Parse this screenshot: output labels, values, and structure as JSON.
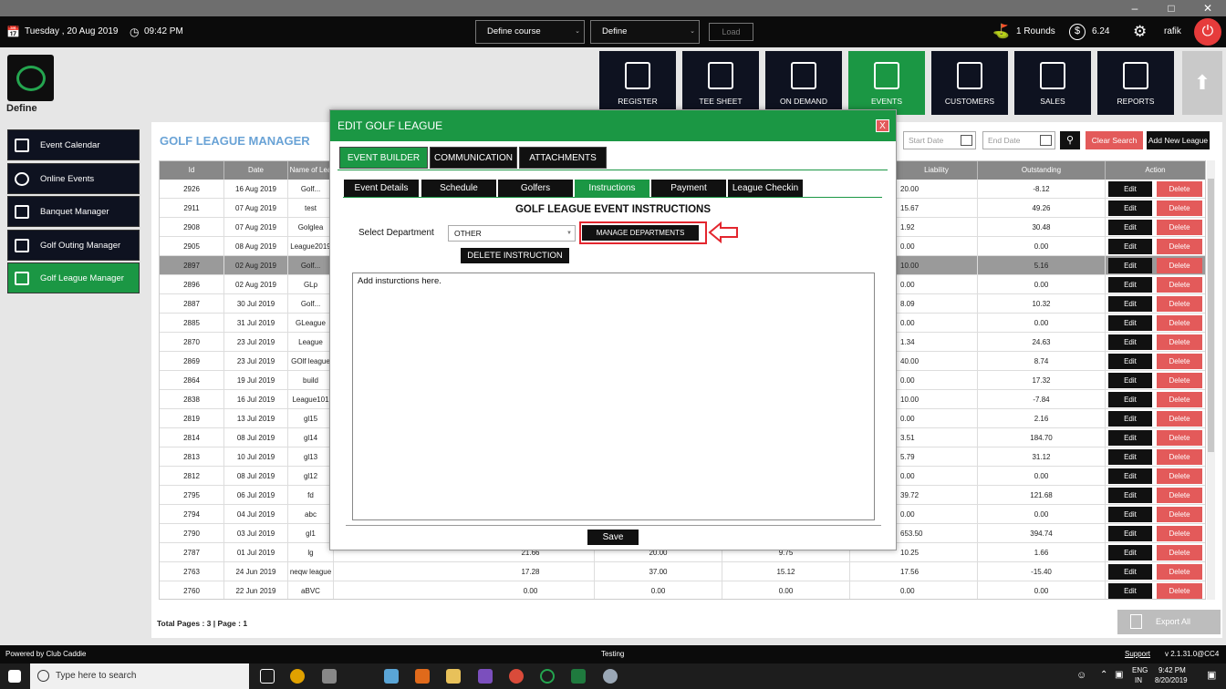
{
  "topbar": {
    "date": "Tuesday ,  20 Aug 2019",
    "time": "09:42 PM",
    "course_select": "Define course",
    "define_select": "Define",
    "load_label": "Load",
    "rounds": "1 Rounds",
    "balance": "6.24",
    "user": "rafik"
  },
  "brand": "Define",
  "nav": [
    {
      "label": "REGISTER",
      "icon": "barcode-scanner-icon"
    },
    {
      "label": "TEE SHEET",
      "icon": "tee-sheet-icon"
    },
    {
      "label": "ON DEMAND",
      "icon": "mobile-icon"
    },
    {
      "label": "EVENTS",
      "icon": "events-calendar-icon",
      "active": true
    },
    {
      "label": "CUSTOMERS",
      "icon": "customers-icon"
    },
    {
      "label": "SALES",
      "icon": "sales-icon"
    },
    {
      "label": "REPORTS",
      "icon": "reports-icon"
    }
  ],
  "sidebar": [
    {
      "label": "Event Calendar"
    },
    {
      "label": "Online Events"
    },
    {
      "label": "Banquet Manager"
    },
    {
      "label": "Golf Outing Manager"
    },
    {
      "label": "Golf League Manager",
      "active": true
    }
  ],
  "page": {
    "title": "GOLF LEAGUE MANAGER",
    "start_date_placeholder": "Start Date",
    "end_date_placeholder": "End Date",
    "clear_search": "Clear Search",
    "add_new": "Add New League",
    "total_pages": "Total Pages : 3 | Page : 1",
    "export_all": "Export All"
  },
  "table": {
    "headers": [
      "Id",
      "Date",
      "Name of Lea",
      "",
      "",
      "",
      "",
      "",
      "Liability",
      "Outstanding",
      "Action"
    ],
    "edit_label": "Edit",
    "delete_label": "Delete",
    "rows": [
      {
        "id": "2926",
        "date": "16 Aug 2019",
        "name": "Golf...",
        "c4": "",
        "c5": "",
        "c6": "",
        "liability": "20.00",
        "outstanding": "-8.12"
      },
      {
        "id": "2911",
        "date": "07 Aug 2019",
        "name": "test",
        "c4": "",
        "c5": "",
        "c6": "",
        "liability": "15.67",
        "outstanding": "49.26"
      },
      {
        "id": "2908",
        "date": "07 Aug 2019",
        "name": "Golglea",
        "c4": "",
        "c5": "",
        "c6": "",
        "liability": "1.92",
        "outstanding": "30.48"
      },
      {
        "id": "2905",
        "date": "08 Aug 2019",
        "name": "League2019",
        "c4": "",
        "c5": "",
        "c6": "",
        "liability": "0.00",
        "outstanding": "0.00"
      },
      {
        "id": "2897",
        "date": "02 Aug 2019",
        "name": "Golf...",
        "c4": "",
        "c5": "",
        "c6": "",
        "liability": "10.00",
        "outstanding": "5.16",
        "selected": true
      },
      {
        "id": "2896",
        "date": "02 Aug 2019",
        "name": "GLp",
        "c4": "",
        "c5": "",
        "c6": "",
        "liability": "0.00",
        "outstanding": "0.00"
      },
      {
        "id": "2887",
        "date": "30 Jul 2019",
        "name": "Golf...",
        "c4": "",
        "c5": "",
        "c6": "",
        "liability": "8.09",
        "outstanding": "10.32"
      },
      {
        "id": "2885",
        "date": "31 Jul 2019",
        "name": "GLeague",
        "c4": "",
        "c5": "",
        "c6": "",
        "liability": "0.00",
        "outstanding": "0.00"
      },
      {
        "id": "2870",
        "date": "23 Jul 2019",
        "name": "League",
        "c4": "",
        "c5": "",
        "c6": "",
        "liability": "1.34",
        "outstanding": "24.63"
      },
      {
        "id": "2869",
        "date": "23 Jul 2019",
        "name": "GOlf league",
        "c4": "",
        "c5": "",
        "c6": "",
        "liability": "40.00",
        "outstanding": "8.74"
      },
      {
        "id": "2864",
        "date": "19 Jul 2019",
        "name": "build",
        "c4": "",
        "c5": "",
        "c6": "",
        "liability": "0.00",
        "outstanding": "17.32"
      },
      {
        "id": "2838",
        "date": "16 Jul 2019",
        "name": "League101",
        "c4": "",
        "c5": "",
        "c6": "",
        "liability": "10.00",
        "outstanding": "-7.84"
      },
      {
        "id": "2819",
        "date": "13 Jul 2019",
        "name": "gl15",
        "c4": "",
        "c5": "",
        "c6": "",
        "liability": "0.00",
        "outstanding": "2.16"
      },
      {
        "id": "2814",
        "date": "08 Jul 2019",
        "name": "gl14",
        "c4": "",
        "c5": "",
        "c6": "",
        "liability": "3.51",
        "outstanding": "184.70"
      },
      {
        "id": "2813",
        "date": "10 Jul 2019",
        "name": "gl13",
        "c4": "",
        "c5": "",
        "c6": "",
        "liability": "5.79",
        "outstanding": "31.12"
      },
      {
        "id": "2812",
        "date": "08 Jul 2019",
        "name": "gl12",
        "c4": "",
        "c5": "",
        "c6": "",
        "liability": "0.00",
        "outstanding": "0.00"
      },
      {
        "id": "2795",
        "date": "06 Jul 2019",
        "name": "fd",
        "c4": "",
        "c5": "",
        "c6": "",
        "liability": "39.72",
        "outstanding": "121.68"
      },
      {
        "id": "2794",
        "date": "04 Jul 2019",
        "name": "abc",
        "c4": "",
        "c5": "",
        "c6": "",
        "liability": "0.00",
        "outstanding": "0.00"
      },
      {
        "id": "2790",
        "date": "03 Jul 2019",
        "name": "gl1",
        "c4": "",
        "c5": "",
        "c6": "",
        "liability": "653.50",
        "outstanding": "394.74"
      },
      {
        "id": "2787",
        "date": "01 Jul 2019",
        "name": "lg",
        "c4": "21.66",
        "c5": "20.00",
        "c6": "9.75",
        "liability": "10.25",
        "outstanding": "1.66"
      },
      {
        "id": "2763",
        "date": "24 Jun 2019",
        "name": "neqw league",
        "c4": "17.28",
        "c5": "37.00",
        "c6": "15.12",
        "liability": "17.56",
        "outstanding": "-15.40"
      },
      {
        "id": "2760",
        "date": "22 Jun 2019",
        "name": "aBVC",
        "c4": "0.00",
        "c5": "0.00",
        "c6": "0.00",
        "liability": "0.00",
        "outstanding": "0.00"
      }
    ]
  },
  "modal": {
    "title": "EDIT GOLF LEAGUE",
    "close": "X",
    "tabs": [
      "EVENT BUILDER",
      "COMMUNICATION",
      "ATTACHMENTS"
    ],
    "subtabs": [
      "Event Details",
      "Schedule",
      "Golfers",
      "Instructions",
      "Payment",
      "League Checkin"
    ],
    "heading": "GOLF LEAGUE EVENT INSTRUCTIONS",
    "dept_label": "Select Department",
    "dept_value": "OTHER",
    "manage_departments": "MANAGE DEPARTMENTS",
    "delete_instruction": "DELETE INSTRUCTION",
    "instructions_text": "Add insturctions here.",
    "save": "Save"
  },
  "footer": {
    "powered": "Powered by Club Caddie",
    "env": "Testing",
    "support": "Support",
    "version": "v 2.1.31.0@CC4"
  },
  "taskbar": {
    "search_placeholder": "Type here to search",
    "lang": "ENG",
    "region": "IN",
    "clock_time": "9:42 PM",
    "clock_date": "8/20/2019"
  },
  "colors": {
    "accent": "#1b9744",
    "danger": "#e35a5a",
    "dark": "#0e1220"
  }
}
